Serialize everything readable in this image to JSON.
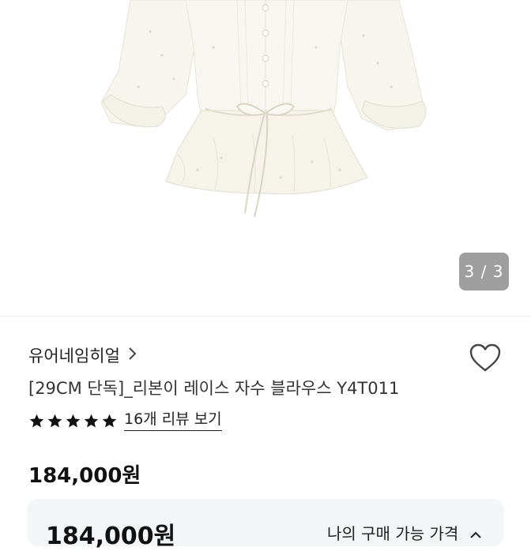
{
  "image_counter": "3 / 3",
  "brand": "유어네임히얼",
  "product": {
    "title": "[29CM 단독]_리본이 레이스 자수 블라우스 Y4T011",
    "rating_stars": 5,
    "review_link": "16개 리뷰 보기",
    "price": "184,000원"
  },
  "price_panel": {
    "price": "184,000원",
    "label": "나의 구매 가능 가격"
  },
  "icons": {
    "brand_chevron": "chevron-right-icon",
    "wishlist": "heart-outline-icon",
    "star": "star-filled-icon",
    "panel_chevron": "chevron-up-icon"
  },
  "colors": {
    "star": "#111111",
    "panel_bg": "#f4f5f7",
    "counter_bg": "#787878"
  }
}
